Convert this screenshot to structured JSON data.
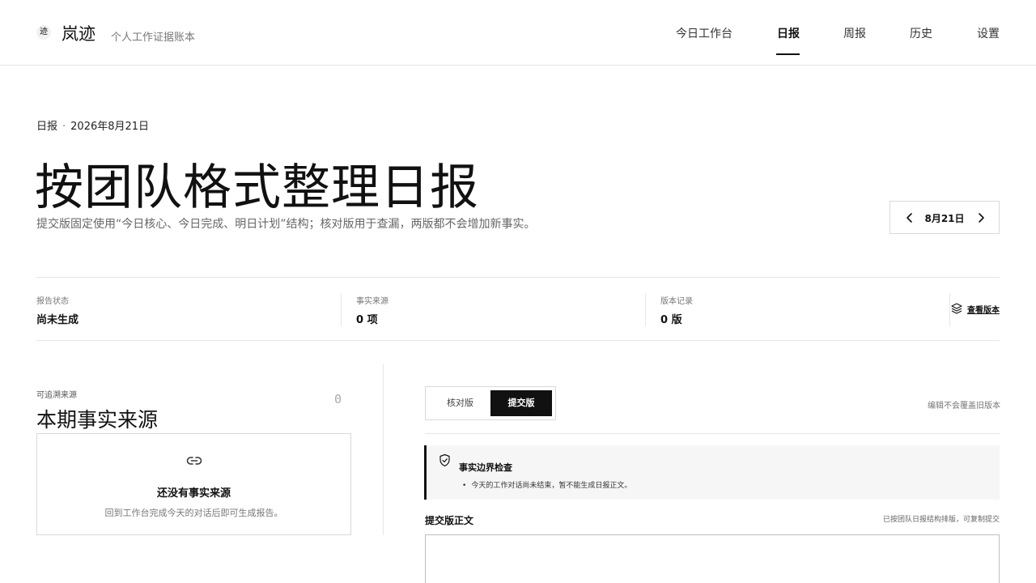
{
  "header": {
    "logo_char": "迹",
    "brand": "岚迹",
    "tagline": "个人工作证据账本",
    "nav": [
      {
        "label": "今日工作台"
      },
      {
        "label": "日报"
      },
      {
        "label": "周报"
      },
      {
        "label": "历史"
      },
      {
        "label": "设置"
      }
    ],
    "active_nav": "日报"
  },
  "hero": {
    "crumb_section": "日报",
    "crumb_sep": "·",
    "crumb_date": "2026年8月21日",
    "title": "按团队格式整理日报",
    "subtitle": "提交版固定使用“今日核心、今日完成、明日计划”结构；核对版用于查漏，两版都不会增加新事实。",
    "date_label": "8月21日"
  },
  "stats": [
    {
      "label": "报告状态",
      "value": "尚未生成"
    },
    {
      "label": "事实来源",
      "value": "0 项"
    },
    {
      "label": "版本记录",
      "value": "0 版"
    }
  ],
  "view_versions_label": "查看版本",
  "sources": {
    "eyebrow": "可追溯来源",
    "title": "本期事实来源",
    "count": "0",
    "empty_title": "还没有事实来源",
    "empty_desc": "回到工作台完成今天的对话后即可生成报告。"
  },
  "editor": {
    "tabs": [
      {
        "label": "核对版"
      },
      {
        "label": "提交版"
      }
    ],
    "active_tab": "提交版",
    "edit_note": "编辑不会覆盖旧版本",
    "check": {
      "title": "事实边界检查",
      "items": [
        "今天的工作对话尚未结束，暂不能生成日报正文。"
      ]
    },
    "body_label": "提交版正文",
    "body_note": "已按团队日报结构排版，可复制提交"
  },
  "icons": {
    "logo": "logo-mark",
    "prev": "chevron-left-icon",
    "next": "chevron-right-icon",
    "versions": "layers-icon",
    "link": "link-icon",
    "shield": "shield-check-icon"
  }
}
